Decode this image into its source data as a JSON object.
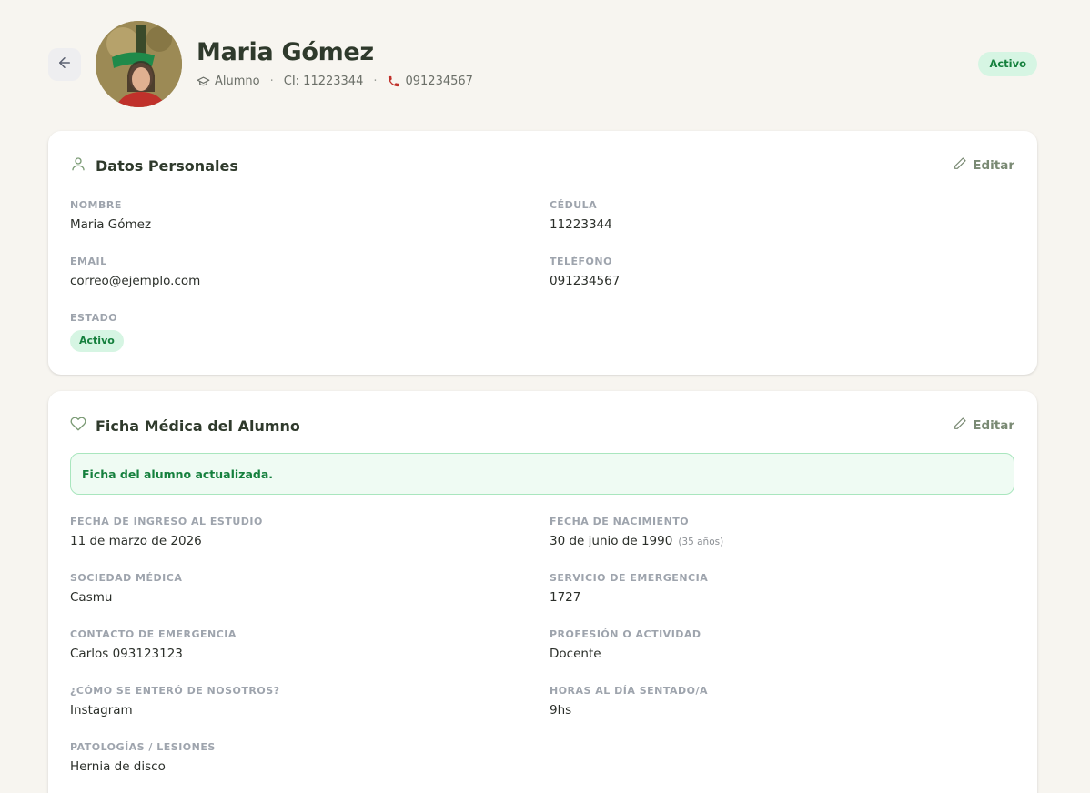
{
  "profile": {
    "name": "Maria Gómez",
    "role": "Alumno",
    "ci": "CI: 11223344",
    "phone": "091234567",
    "status": "Activo",
    "role_icon": "graduation-cap-icon",
    "phone_icon": "phone-icon",
    "back_icon": "arrow-left-icon"
  },
  "personal": {
    "title": "Datos Personales",
    "title_icon": "user-icon",
    "edit_label": "Editar",
    "fields": {
      "nombre": {
        "label": "Nombre",
        "value": "Maria Gómez"
      },
      "cedula": {
        "label": "Cédula",
        "value": "11223344"
      },
      "email": {
        "label": "Email",
        "value": "correo@ejemplo.com"
      },
      "telefono": {
        "label": "Teléfono",
        "value": "091234567"
      },
      "estado": {
        "label": "Estado",
        "value": "Activo"
      }
    }
  },
  "medical": {
    "title": "Ficha Médica del Alumno",
    "title_icon": "heart-icon",
    "edit_label": "Editar",
    "alert": "Ficha del alumno actualizada.",
    "fields": {
      "ingreso": {
        "label": "Fecha de ingreso al estudio",
        "value": "11 de marzo de 2026"
      },
      "nacimiento": {
        "label": "Fecha de nacimiento",
        "value": "30 de junio de 1990",
        "age": "(35 años)"
      },
      "sociedad": {
        "label": "Sociedad médica",
        "value": "Casmu"
      },
      "emergencia": {
        "label": "Servicio de emergencia",
        "value": "1727"
      },
      "contacto": {
        "label": "Contacto de emergencia",
        "value": "Carlos 093123123"
      },
      "profesion": {
        "label": "Profesión o actividad",
        "value": "Docente"
      },
      "como": {
        "label": "¿Cómo se enteró de nosotros?",
        "value": "Instagram"
      },
      "horas": {
        "label": "Horas al día sentado/a",
        "value": "9hs"
      },
      "patologias": {
        "label": "Patologías / Lesiones",
        "value": "Hernia de disco"
      }
    }
  },
  "colors": {
    "background": "#f7f5f0",
    "accent_green": "#15803d",
    "badge_bg": "#d6f5e3",
    "title_text": "#2f3a2c"
  }
}
